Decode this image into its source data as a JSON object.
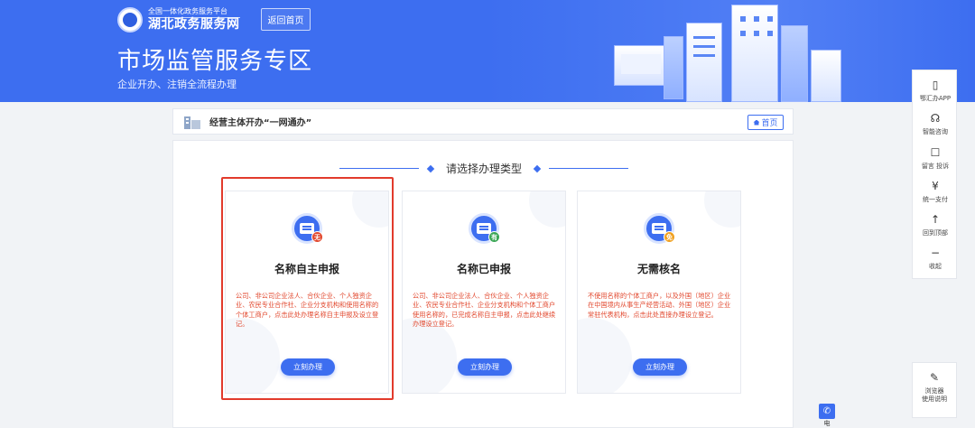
{
  "header": {
    "platform_label": "全国一体化政务服务平台",
    "site_name": "湖北政务服务网",
    "back_button": "返回首页",
    "title": "市场监管服务专区",
    "subtitle": "企业开办、注销全流程办理"
  },
  "crumb": {
    "text": "经营主体开办“一网通办”",
    "home_button": "首页"
  },
  "section": {
    "title": "请选择办理类型"
  },
  "cards": [
    {
      "title": "名称自主申报",
      "badge": "无",
      "badge_color": "#e2492f",
      "description": "公司、非公司企业法人、合伙企业、个人独资企业、农民专业合作社、企业分支机构和使用名称的个体工商户，点击此处办理名称自主申报及设立登记。",
      "button": "立刻办理",
      "selected": true
    },
    {
      "title": "名称已申报",
      "badge": "有",
      "badge_color": "#3aa655",
      "description": "公司、非公司企业法人、合伙企业、个人独资企业、农民专业合作社、企业分支机构和个体工商户使用名称的，已完成名称自主申报，点击此处继续办理设立登记。",
      "button": "立刻办理",
      "selected": false
    },
    {
      "title": "无需核名",
      "badge": "免",
      "badge_color": "#f0a020",
      "description": "不使用名称的个体工商户，以及外国（地区）企业在中国境内从事生产经营活动、外国（地区）企业常驻代表机构，点击此处直接办理设立登记。",
      "button": "立刻办理",
      "selected": false
    }
  ],
  "float_menu": [
    {
      "icon": "▯",
      "label": "鄂汇办APP"
    },
    {
      "icon": "☊",
      "label": "智能咨询"
    },
    {
      "icon": "☐",
      "label": "留言 投诉"
    },
    {
      "icon": "¥",
      "label": "统一支付"
    },
    {
      "icon": "↑",
      "label": "回到顶部"
    },
    {
      "icon": "−",
      "label": "收起"
    }
  ],
  "help": {
    "icon": "✎",
    "label_line1": "浏览器",
    "label_line2": "使用说明"
  },
  "phone_tab": {
    "icon": "✆",
    "label": "电"
  },
  "colors": {
    "brand_blue": "#3d6ef0",
    "desc_red": "#e2492f",
    "highlight_red": "#e23b2c"
  }
}
